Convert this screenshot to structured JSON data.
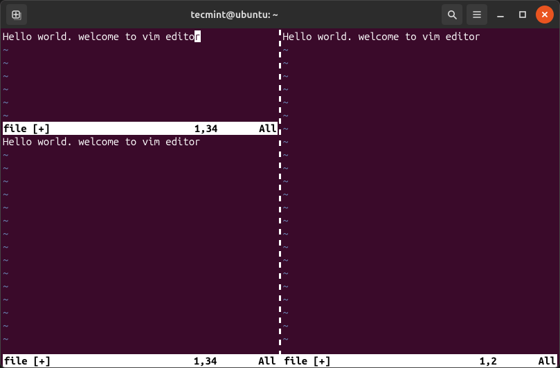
{
  "window": {
    "title": "tecmint@ubuntu: ~"
  },
  "titlebar_icons": {
    "newtab": "new-tab-icon",
    "search": "search-icon",
    "menu": "hamburger-menu-icon",
    "minimize": "minimize-icon",
    "maximize": "maximize-icon",
    "close": "close-icon"
  },
  "vim": {
    "tilde": "~",
    "panes": {
      "top_left": {
        "content_pre": "Hello world. welcome to vim edito",
        "cursor_char": "r",
        "content_post": "",
        "status": {
          "name": "file [+]",
          "pos": "1,34",
          "pct": "All"
        },
        "tilde_rows": 6
      },
      "right": {
        "content": "Hello world. welcome to vim editor",
        "tilde_rows": 23
      },
      "bottom_left": {
        "content": "Hello world. welcome to vim editor",
        "tilde_rows": 15
      }
    },
    "bottom_status": {
      "left": {
        "name": "file [+]",
        "pos": "1,34",
        "pct": "All"
      },
      "right": {
        "name": "file [+]",
        "pos": "1,2",
        "pct": "All"
      }
    }
  }
}
